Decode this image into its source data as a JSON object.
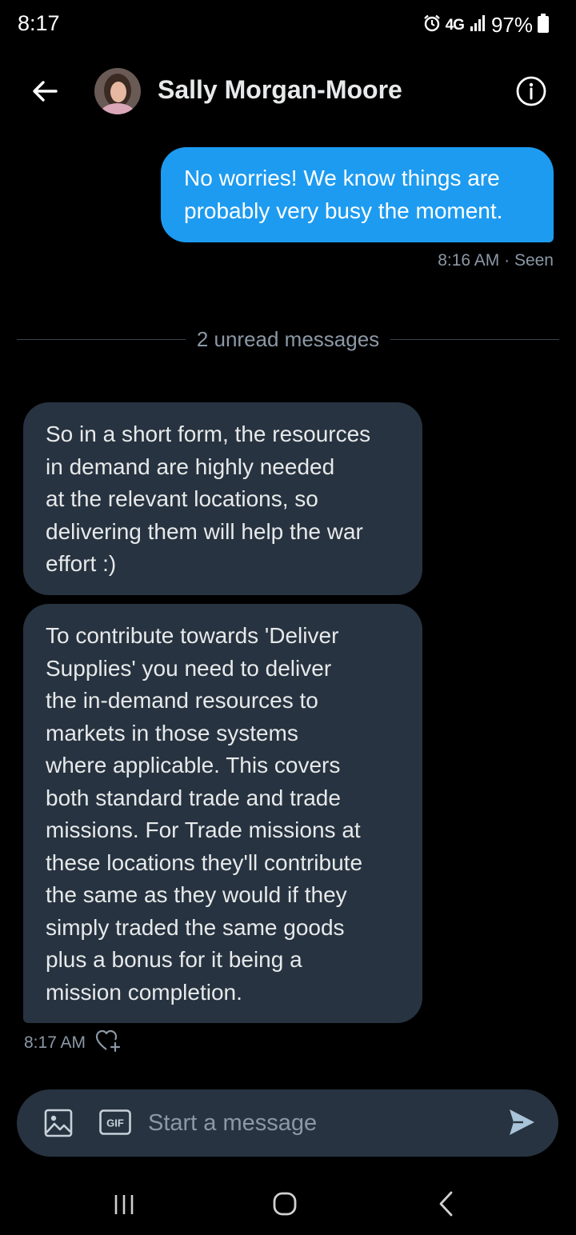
{
  "status_bar": {
    "time": "8:17",
    "network": "4G",
    "battery": "97%"
  },
  "header": {
    "contact_name": "Sally Morgan-Moore"
  },
  "messages": {
    "sent": {
      "text": "No worries! We know things are\nprobably very busy the moment.",
      "meta": "8:16 AM · Seen"
    },
    "unread_divider": "2 unread messages",
    "received": [
      {
        "text": "So in a short form, the resources\nin demand are highly needed\nat the relevant locations, so\ndelivering them will help the war\neffort :)"
      },
      {
        "text": "To contribute towards 'Deliver\nSupplies' you need to deliver\nthe in-demand resources to\nmarkets in those systems\nwhere applicable. This covers\nboth standard trade and trade\nmissions. For Trade missions at\nthese locations they'll contribute\nthe same as they would if they\nsimply traded the same goods\nplus a bonus for it being a\nmission completion."
      }
    ],
    "received_time": "8:17 AM"
  },
  "composer": {
    "placeholder": "Start a message",
    "gif_label": "GIF"
  },
  "icons": {
    "back": "arrow-left-icon",
    "info": "info-icon",
    "image": "image-icon",
    "gif": "gif-icon",
    "send": "send-icon",
    "react": "heart-plus-icon",
    "alarm": "alarm-icon",
    "signal": "signal-icon",
    "battery": "battery-icon"
  },
  "colors": {
    "background": "#000000",
    "sent_bubble": "#1d9bf0",
    "received_bubble": "#273340",
    "secondary_text": "#8b98a5"
  }
}
